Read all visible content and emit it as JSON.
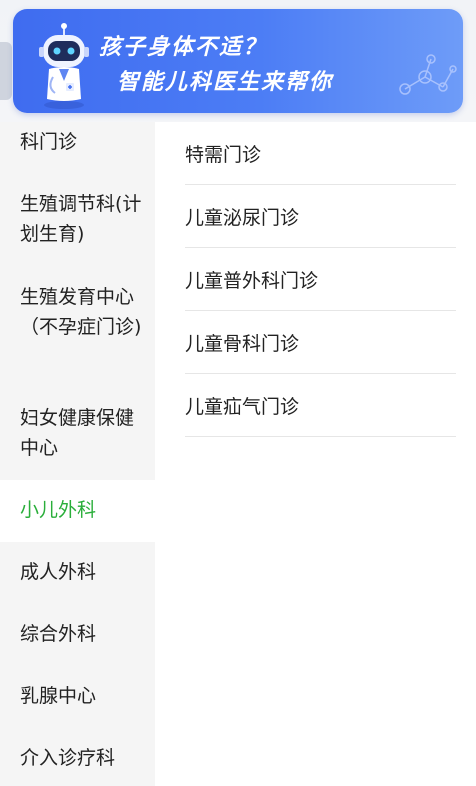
{
  "banner": {
    "title": "孩子身体不适？",
    "subtitle": "智能儿科医生来帮你"
  },
  "sidebar": {
    "items": [
      {
        "label": "科门诊",
        "active": false
      },
      {
        "label": "生殖调节科(计划生育)",
        "active": false
      },
      {
        "label": "生殖发育中心（不孕症门诊)",
        "active": false
      },
      {
        "label": "妇女健康保健中心",
        "active": false
      },
      {
        "label": "小儿外科",
        "active": true
      },
      {
        "label": "成人外科",
        "active": false
      },
      {
        "label": "综合外科",
        "active": false
      },
      {
        "label": "乳腺中心",
        "active": false
      },
      {
        "label": "介入诊疗科",
        "active": false
      }
    ]
  },
  "sub_list": {
    "items": [
      "特需门诊",
      "儿童泌尿门诊",
      "儿童普外科门诊",
      "儿童骨科门诊",
      "儿童疝气门诊"
    ]
  },
  "colors": {
    "accent_green": "#2aae3a",
    "banner_blue": "#4c7df5",
    "sidebar_bg": "#f5f5f5"
  }
}
